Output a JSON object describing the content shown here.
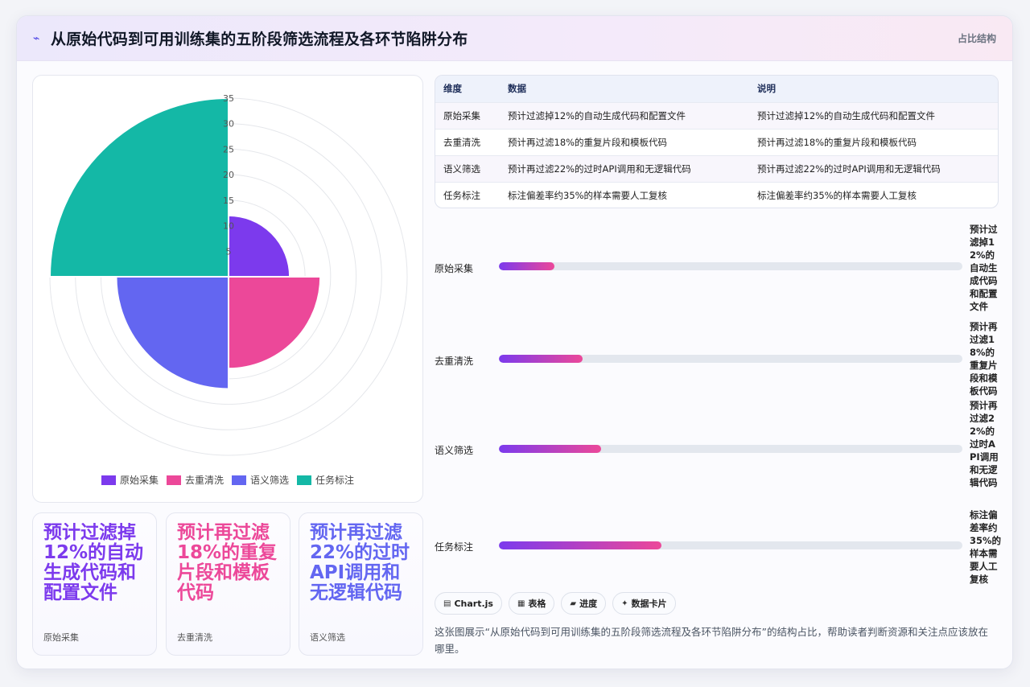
{
  "header": {
    "title": "从原始代码到可用训练集的五阶段筛选流程及各环节陷阱分布",
    "icon": "chart-pulse-icon",
    "tag": "占比结构"
  },
  "chart_data": {
    "type": "polar-area",
    "categories": [
      "原始采集",
      "去重清洗",
      "语义筛选",
      "任务标注"
    ],
    "values": [
      12,
      18,
      22,
      35
    ],
    "colors": [
      "#7c3aed",
      "#ec4899",
      "#6366f1",
      "#14b8a6"
    ],
    "rticks": [
      "5",
      "10",
      "15",
      "20",
      "25",
      "30",
      "35"
    ],
    "rmax": 35,
    "grid": true,
    "legend": "bottom"
  },
  "table": {
    "headers": [
      "维度",
      "数据",
      "说明"
    ],
    "rows": [
      [
        "原始采集",
        "预计过滤掉12%的自动生成代码和配置文件",
        "预计过滤掉12%的自动生成代码和配置文件"
      ],
      [
        "去重清洗",
        "预计再过滤18%的重复片段和模板代码",
        "预计再过滤18%的重复片段和模板代码"
      ],
      [
        "语义筛选",
        "预计再过滤22%的过时API调用和无逻辑代码",
        "预计再过滤22%的过时API调用和无逻辑代码"
      ],
      [
        "任务标注",
        "标注偏差率约35%的样本需要人工复核",
        "标注偏差率约35%的样本需要人工复核"
      ]
    ]
  },
  "progress": [
    {
      "name": "原始采集",
      "value": 12,
      "note": "预计过滤掉12%的自动生成代码和配置文件"
    },
    {
      "name": "去重清洗",
      "value": 18,
      "note": "预计再过滤18%的重复片段和模板代码"
    },
    {
      "name": "语义筛选",
      "value": 22,
      "note": "预计再过滤22%的过时API调用和无逻辑代码"
    },
    {
      "name": "任务标注",
      "value": 35,
      "note": "标注偏差率约35%的样本需要人工复核"
    }
  ],
  "progress_max": 100,
  "stats": [
    {
      "big": "预计过滤掉12%的自动生成代码和配置文件",
      "label": "原始采集",
      "color": "#7c3aed"
    },
    {
      "big": "预计再过滤18%的重复片段和模板代码",
      "label": "去重清洗",
      "color": "#ec4899"
    },
    {
      "big": "预计再过滤22%的过时API调用和无逻辑代码",
      "label": "语义筛选",
      "color": "#6366f1"
    }
  ],
  "chips": [
    {
      "icon": "chart-icon",
      "glyph": "▤",
      "label": "Chart.js"
    },
    {
      "icon": "table-icon",
      "glyph": "▦",
      "label": "表格"
    },
    {
      "icon": "progress-icon",
      "glyph": "▰",
      "label": "进度"
    },
    {
      "icon": "card-icon",
      "glyph": "✦",
      "label": "数据卡片"
    }
  ],
  "description": "这张图展示“从原始代码到可用训练集的五阶段筛选流程及各环节陷阱分布”的结构占比，帮助读者判断资源和关注点应该放在哪里。"
}
